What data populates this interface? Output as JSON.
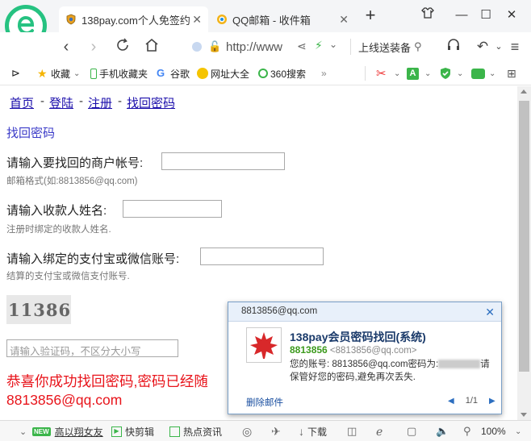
{
  "browser": {
    "tabs": [
      {
        "title": "138pay.com个人免签约",
        "active": true
      },
      {
        "title": "QQ邮箱 - 收件箱",
        "active": false
      }
    ],
    "address": "http://www",
    "search_text": "上线送装备",
    "colors": {
      "accent": "#26c281"
    }
  },
  "bookmarks": [
    {
      "label": "收藏",
      "icon": "star-icon"
    },
    {
      "label": "手机收藏夹",
      "icon": "phone-icon"
    },
    {
      "label": "谷歌",
      "icon": "google-icon"
    },
    {
      "label": "网址大全",
      "icon": "site-icon"
    },
    {
      "label": "360搜索",
      "icon": "search-icon"
    }
  ],
  "page": {
    "nav": [
      "首页",
      "登陆",
      "注册",
      "找回密码"
    ],
    "nav_sep": "-",
    "section_title": "找回密码",
    "fields": [
      {
        "label": "请输入要找回的商户帐号:",
        "hint": "邮箱格式(如:8813856@qq.com)"
      },
      {
        "label": "请输入收款人姓名:",
        "hint": "注册时绑定的收款人姓名."
      },
      {
        "label": "请输入绑定的支付宝或微信账号:",
        "hint": "结算的支付宝或微信支付账号."
      }
    ],
    "captcha_text": "11386",
    "vcode_placeholder": "请输入验证码，不区分大小写",
    "success_line1": "恭喜你成功找回密码,密码已经随",
    "success_line2": "8813856@qq.com"
  },
  "popup": {
    "account": "8813856@qq.com",
    "title": "138pay会员密码找回(系统)",
    "sender_name": "8813856",
    "sender_email": "<8813856@qq.com>",
    "body_prefix": "您的账号: 8813856@qq.com密码为:",
    "body_suffix": "请保管好您的密码,避免再次丢失.",
    "delete_label": "删除邮件",
    "page_indicator": "1/1"
  },
  "statusbar": {
    "new_badge": "NEW",
    "news": "高以翔女友",
    "items": [
      "快剪辑",
      "热点资讯",
      "下载"
    ],
    "zoom": "100%"
  }
}
